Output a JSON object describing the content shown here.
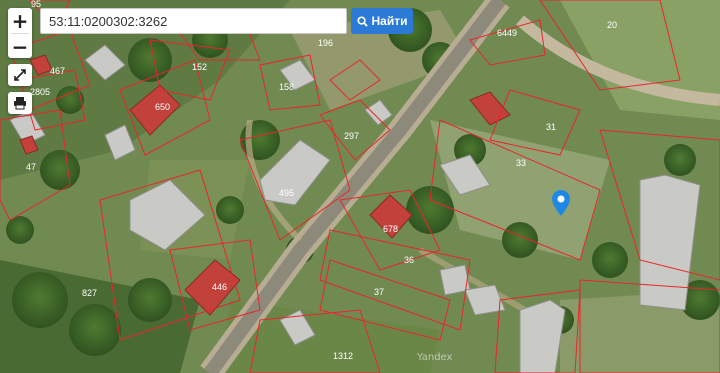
{
  "map": {
    "search": {
      "value": "53:11:0200302:3262",
      "placeholder": ""
    },
    "find_label": "Найти",
    "watermark": "Yandex",
    "parcel_color": "#e8262b",
    "marker_color": "#1e88e5",
    "parcels": [
      "95",
      "467",
      "2805",
      "47",
      "152",
      "196",
      "158",
      "650",
      "297",
      "495",
      "6449",
      "20",
      "31",
      "33",
      "827",
      "446",
      "678",
      "36",
      "37",
      "1312"
    ]
  }
}
